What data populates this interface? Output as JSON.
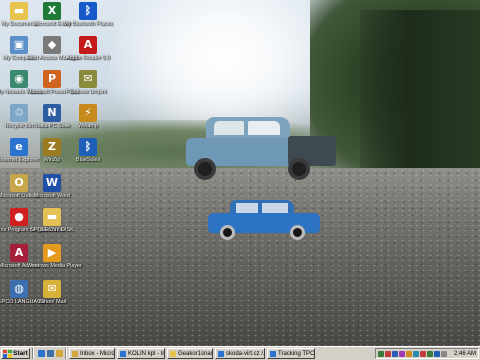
{
  "desktop": {
    "icons": [
      {
        "label": "My Documents",
        "icon": "folder-icon",
        "color": "#e8c44e",
        "glyph": "▬"
      },
      {
        "label": "Microsoft Excel",
        "icon": "excel-icon",
        "color": "#1f7a3a",
        "glyph": "X"
      },
      {
        "label": "My Bluetooth Places",
        "icon": "bluetooth-icon",
        "color": "#1659c9",
        "glyph": "ᛒ"
      },
      {
        "label": "My Computer",
        "icon": "computer-icon",
        "color": "#5b8fc7",
        "glyph": "▣"
      },
      {
        "label": "Host Access Manager",
        "icon": "host-access-icon",
        "color": "#7a7a7a",
        "glyph": "◆"
      },
      {
        "label": "Adobe Reader 6.0",
        "icon": "adobe-reader-icon",
        "color": "#c41a1a",
        "glyph": "A"
      },
      {
        "label": "My Network Places",
        "icon": "network-icon",
        "color": "#3b8a70",
        "glyph": "◉"
      },
      {
        "label": "Microsoft PowerPoint",
        "icon": "powerpoint-icon",
        "color": "#d0641e",
        "glyph": "P"
      },
      {
        "label": "Outlook Unipint",
        "icon": "outlook-unipint-icon",
        "color": "#8a8a3c",
        "glyph": "✉"
      },
      {
        "label": "Recycle Bin",
        "icon": "recycle-bin-icon",
        "color": "#7ea7c7",
        "glyph": "♲"
      },
      {
        "label": "Nokia PC Suite",
        "icon": "nokia-pc-suite-icon",
        "color": "#2d5ca0",
        "glyph": "N"
      },
      {
        "label": "Winamp",
        "icon": "winamp-icon",
        "color": "#c98a1d",
        "glyph": "⚡"
      },
      {
        "label": "Internet Explorer",
        "icon": "internet-explorer-icon",
        "color": "#2a74d0",
        "glyph": "e"
      },
      {
        "label": "WinZip",
        "icon": "winzip-icon",
        "color": "#9b7a22",
        "glyph": "Z"
      },
      {
        "label": "BlueSoleil",
        "icon": "bluesoleil-icon",
        "color": "#1e5fb8",
        "glyph": "ᛒ"
      },
      {
        "label": "Microsoft Outlook",
        "icon": "outlook-icon",
        "color": "#c8a64a",
        "glyph": "O"
      },
      {
        "label": "Microsoft Word",
        "icon": "word-icon",
        "color": "#1f4fa6",
        "glyph": "W"
      },
      {
        "label": "Citrix Program Neighborhood",
        "icon": "citrix-icon",
        "color": "#d11f1f",
        "glyph": "●"
      },
      {
        "label": "SPOLECNY DISK",
        "icon": "shared-disk-icon",
        "color": "#e5c155",
        "glyph": "▬"
      },
      {
        "label": "Microsoft Access",
        "icon": "access-icon",
        "color": "#a61f3a",
        "glyph": "A"
      },
      {
        "label": "Windows Media Player",
        "icon": "media-player-icon",
        "color": "#e39a1e",
        "glyph": "▶"
      },
      {
        "label": "GEPCO LANGUAGE ...",
        "icon": "gepco-language-icon",
        "color": "#3e6fb0",
        "glyph": "◍"
      },
      {
        "label": "Yahoo! Mail",
        "icon": "yahoo-mail-icon",
        "color": "#d7b23a",
        "glyph": "✉"
      }
    ]
  },
  "taskbar": {
    "start_label": "Start",
    "quick_launch": [
      {
        "icon": "quick-launch-ie-icon",
        "color": "#2a74d0"
      },
      {
        "icon": "quick-launch-desktop-icon",
        "color": "#3f6fa8"
      },
      {
        "icon": "quick-launch-outlook-icon",
        "color": "#d4a63a"
      }
    ],
    "buttons": [
      {
        "label": "Inbox - Micros...",
        "icon": "outlook-task-icon",
        "color": "#d4a63a",
        "active": false
      },
      {
        "label": "KOLIN kpl - In...",
        "icon": "ie-task-icon",
        "color": "#2a74d0",
        "active": false
      },
      {
        "label": "Geakor1snas...",
        "icon": "folder-task-icon",
        "color": "#e8c44e",
        "active": false
      },
      {
        "label": "skoda-virt.cz /...",
        "icon": "ie-task-icon",
        "color": "#2a74d0",
        "active": false
      },
      {
        "label": "Tracking TPCA...",
        "icon": "ie-task-icon",
        "color": "#2a74d0",
        "active": false
      }
    ],
    "tray_icons": [
      "#3a7a3a",
      "#c23b3b",
      "#2a5cb8",
      "#a03ab0",
      "#d28a1e",
      "#2a8ab0",
      "#c23b3b",
      "#3a7a3a",
      "#1e5fb8",
      "#888888"
    ],
    "clock": "2:46 AM"
  }
}
